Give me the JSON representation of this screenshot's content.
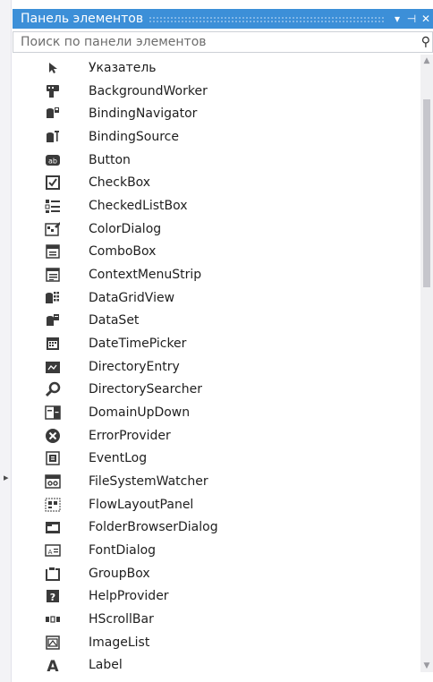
{
  "toolbox": {
    "title": "Панель элементов",
    "pin_glyph": "⊣",
    "dropdown_glyph": "▾",
    "close_glyph": "✕",
    "search_placeholder": "Поиск по панели элементов",
    "search_icon_glyph": "⚲"
  },
  "items": [
    {
      "label": "Указатель",
      "icon": "pointer-icon"
    },
    {
      "label": "BackgroundWorker",
      "icon": "background-worker-icon"
    },
    {
      "label": "BindingNavigator",
      "icon": "binding-navigator-icon"
    },
    {
      "label": "BindingSource",
      "icon": "binding-source-icon"
    },
    {
      "label": "Button",
      "icon": "button-icon"
    },
    {
      "label": "CheckBox",
      "icon": "checkbox-icon"
    },
    {
      "label": "CheckedListBox",
      "icon": "checked-list-box-icon"
    },
    {
      "label": "ColorDialog",
      "icon": "color-dialog-icon"
    },
    {
      "label": "ComboBox",
      "icon": "combo-box-icon"
    },
    {
      "label": "ContextMenuStrip",
      "icon": "context-menu-strip-icon"
    },
    {
      "label": "DataGridView",
      "icon": "data-grid-view-icon"
    },
    {
      "label": "DataSet",
      "icon": "data-set-icon"
    },
    {
      "label": "DateTimePicker",
      "icon": "date-time-picker-icon"
    },
    {
      "label": "DirectoryEntry",
      "icon": "directory-entry-icon"
    },
    {
      "label": "DirectorySearcher",
      "icon": "directory-searcher-icon"
    },
    {
      "label": "DomainUpDown",
      "icon": "domain-up-down-icon"
    },
    {
      "label": "ErrorProvider",
      "icon": "error-provider-icon"
    },
    {
      "label": "EventLog",
      "icon": "event-log-icon"
    },
    {
      "label": "FileSystemWatcher",
      "icon": "file-system-watcher-icon"
    },
    {
      "label": "FlowLayoutPanel",
      "icon": "flow-layout-panel-icon"
    },
    {
      "label": "FolderBrowserDialog",
      "icon": "folder-browser-dialog-icon"
    },
    {
      "label": "FontDialog",
      "icon": "font-dialog-icon"
    },
    {
      "label": "GroupBox",
      "icon": "group-box-icon"
    },
    {
      "label": "HelpProvider",
      "icon": "help-provider-icon"
    },
    {
      "label": "HScrollBar",
      "icon": "hscrollbar-icon"
    },
    {
      "label": "ImageList",
      "icon": "image-list-icon"
    },
    {
      "label": "Label",
      "icon": "label-icon"
    }
  ],
  "colors": {
    "titlebar": "#3c8fd8",
    "icon": "#3a3a3a",
    "text": "#1e1e1e"
  }
}
